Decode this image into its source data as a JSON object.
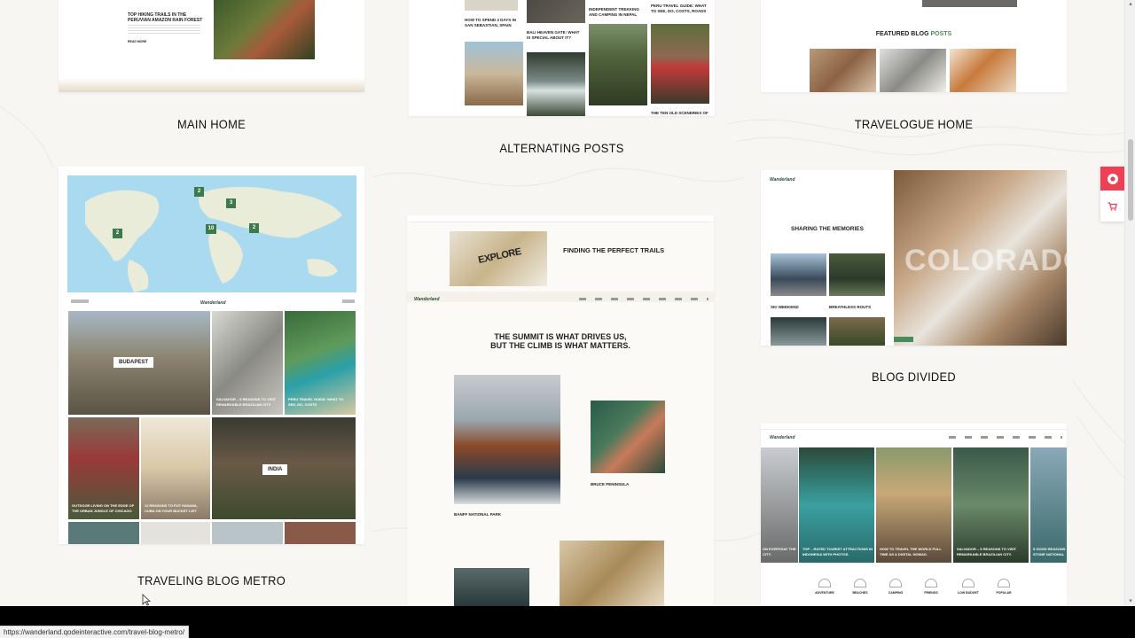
{
  "demos": {
    "main_home": {
      "title": "MAIN HOME",
      "post_title": "TOP HIKING TRAILS IN THE PERUVIAN AMAZON RAIN FOREST",
      "read_more": "READ MORE"
    },
    "alternating_posts": {
      "title": "ALTERNATING POSTS",
      "posts": [
        "HOW TO SPEND 3 DAYS IN SAN SEBASTIAN, SPAIN",
        "INDEPENDENT TREKKING AND CAMPING IN NEPAL",
        "PERU TRAVEL GUIDE: WHAT TO SEE, DO, COSTS, ROADS",
        "BALI HEAVEN GATE: WHAT IS SPECIAL ABOUT IT?",
        "THE TEN OLD SCENERIES OF"
      ]
    },
    "travelogue_home": {
      "title": "TRAVELOGUE HOME",
      "featured_label": "FEATURED BLOG",
      "featured_accent": "POSTS"
    },
    "traveling_blog_metro": {
      "title": "TRAVELING BLOG METRO",
      "map_markers": [
        "2",
        "3",
        "10",
        "2",
        "2"
      ],
      "tile_labels": [
        "BUDAPEST",
        "INDIA"
      ],
      "posts": [
        "SALVADOR – 5 REASONS TO VISIT REMARKABLE BRAZILIAN CITY",
        "PERU TRAVEL GUIDE: WHAT TO SEE, DO, COSTS",
        "OUTDOOR LIVING ON THE EDGE OF THE URBAN JUNGLE OF CHICAGO",
        "12 REASONS TO PUT HAVANA, CUBA ON YOUR BUCKET LIST"
      ]
    },
    "center_demo": {
      "banner_heading": "FINDING THE PERFECT TRAILS",
      "explore_word": "EXPLORE",
      "headline_1": "THE SUMMIT IS WHAT DRIVES US,",
      "headline_2": "BUT THE CLIMB IS WHAT MATTERS.",
      "captions": [
        "BANFF NATIONAL PARK",
        "BRUCE PENINSULA"
      ]
    },
    "blog_divided": {
      "title": "BLOG DIVIDED",
      "section_heading": "SHARING THE MEMORIES",
      "hero_text": "COLORADO",
      "posts": [
        "SKI WEEKEND",
        "BREATHLESS ROUTS"
      ]
    },
    "bottom_right_demo": {
      "posts": [
        "ON EVERYDAY THE CITY.",
        "TOP – RATED TOURIST ATTRACTIONS IN INDONESIA WITH PHOTOS.",
        "HOW TO TRAVEL THE WORLD FULL TIME AS A DIGITAL NOMAD.",
        "SALVADOR – 5 REASONS TO VISIT REMARKABLE BRAZILIAN CITY.",
        "5 GOOD REASONS STONE NATIONAL"
      ],
      "categories": [
        "ADVENTURE",
        "BEACHES",
        "CAMPING",
        "FRIENDS",
        "LOW BUDGET",
        "POPULAR"
      ]
    }
  },
  "brand_logo": "Wanderland",
  "status_url": "https://wanderland.qodeinteractive.com/travel-blog-metro/",
  "colors": {
    "accent": "#ef3f54",
    "green": "#4a8a5a",
    "bg": "#f7f6f2"
  },
  "icons": {
    "side_top": "lifebuoy-icon",
    "side_bottom": "cart-icon"
  }
}
